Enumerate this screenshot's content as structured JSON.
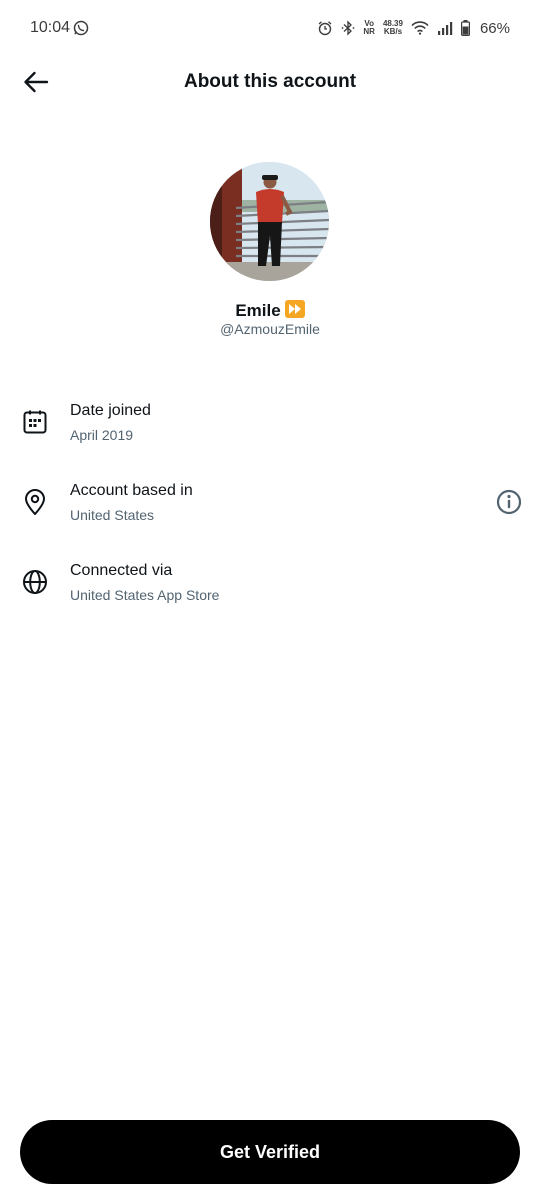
{
  "status_bar": {
    "time": "10:04",
    "network_speed_value": "48.39",
    "network_speed_unit": "KB/s",
    "volte_top": "Vo",
    "volte_bottom": "NR",
    "battery": "66%",
    "icons": [
      "whatsapp-icon",
      "alarm-icon",
      "bluetooth-icon",
      "volte-icon",
      "wifi-icon",
      "signal-icon",
      "battery-icon"
    ]
  },
  "header": {
    "title": "About this account",
    "back_icon": "back-arrow-icon"
  },
  "profile": {
    "name": "Emile",
    "badge_icon": "fast-forward-emoji",
    "handle": "@AzmouzEmile"
  },
  "details": [
    {
      "icon": "calendar-icon",
      "label": "Date joined",
      "value": "April 2019"
    },
    {
      "icon": "location-pin-icon",
      "label": "Account based in",
      "value": "United States",
      "info_icon": "info-icon"
    },
    {
      "icon": "globe-icon",
      "label": "Connected via",
      "value": "United States App Store"
    }
  ],
  "cta": {
    "label": "Get Verified"
  },
  "colors": {
    "text_primary": "#0f1419",
    "text_secondary": "#536471",
    "button_bg": "#000000",
    "button_text": "#ffffff",
    "badge": "#f5a623"
  }
}
